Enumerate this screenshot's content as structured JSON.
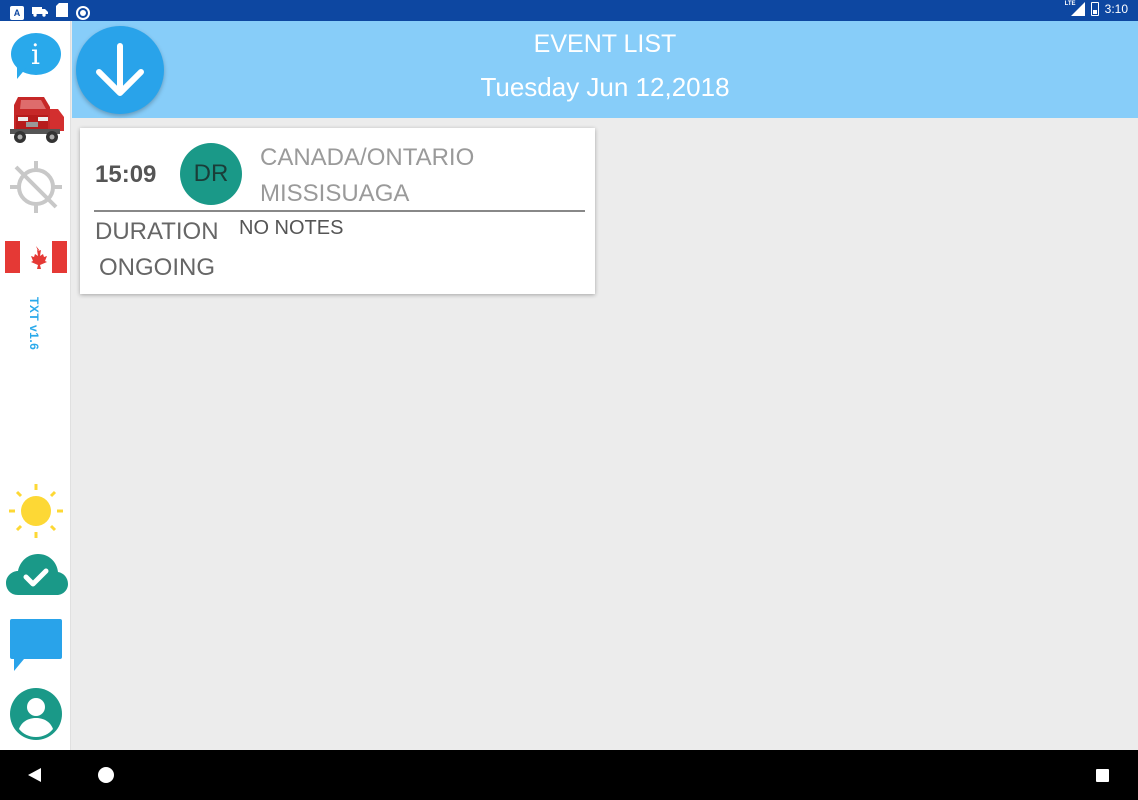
{
  "status_bar": {
    "left_icons": [
      "a-icon",
      "truck-icon",
      "sd-card-icon",
      "record-icon"
    ],
    "network": "LTE",
    "time": "3:10"
  },
  "sidebar": {
    "items": [
      {
        "name": "info-icon",
        "label": "i"
      },
      {
        "name": "truck-icon"
      },
      {
        "name": "gps-off-icon"
      },
      {
        "name": "canada-flag-icon"
      },
      {
        "name": "sun-icon"
      },
      {
        "name": "cloud-check-icon"
      },
      {
        "name": "chat-icon"
      },
      {
        "name": "user-icon"
      }
    ],
    "version": "TXT v1.6"
  },
  "header": {
    "title": "EVENT LIST",
    "date": "Tuesday Jun 12,2018",
    "colors": {
      "background": "#87cdf9",
      "button": "#29a3ea"
    }
  },
  "event": {
    "time": "15:09",
    "status": "DR",
    "location_line1": "CANADA/ONTARIO",
    "location_line2": "MISSISUAGA",
    "duration_label": "DURATION",
    "duration_value": "ONGOING",
    "notes": "NO NOTES",
    "status_color": "#1a9988"
  }
}
